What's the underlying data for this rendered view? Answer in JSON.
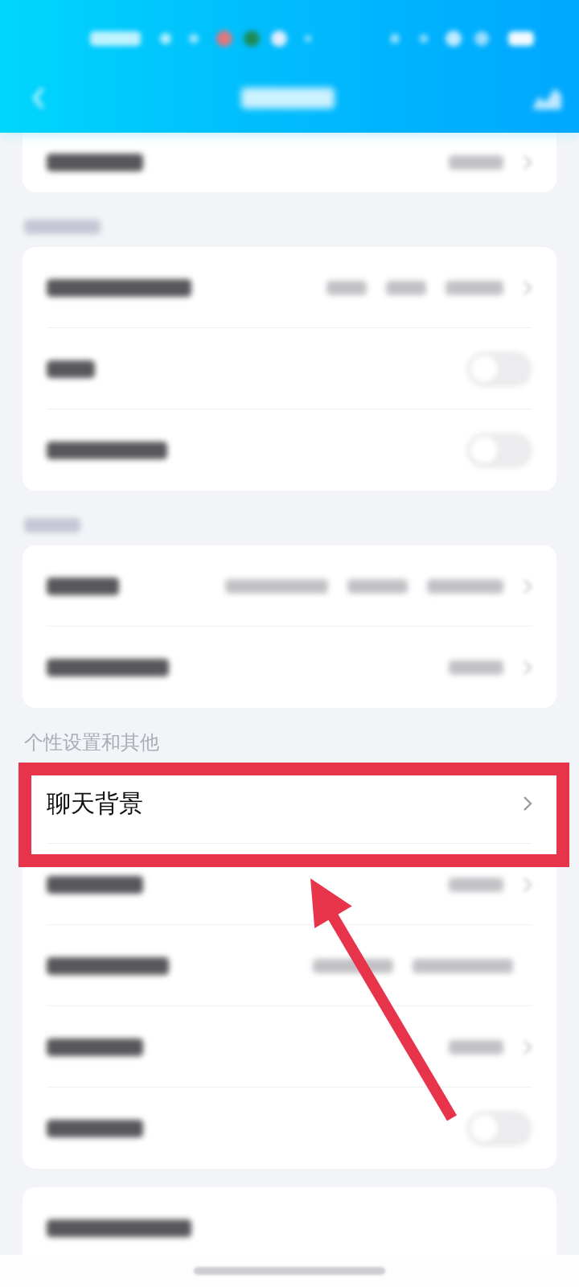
{
  "sections": [
    {
      "rows": [
        {
          "kind": "link",
          "blurred": true
        }
      ]
    },
    {
      "heading_blurred": true,
      "rows": [
        {
          "kind": "link",
          "blurred": true
        },
        {
          "kind": "switch",
          "blurred": true,
          "on": false
        },
        {
          "kind": "switch",
          "blurred": true,
          "on": false
        }
      ]
    },
    {
      "heading_blurred": true,
      "rows": [
        {
          "kind": "link",
          "blurred": true
        },
        {
          "kind": "link",
          "blurred": true
        }
      ]
    },
    {
      "heading": "个性设置和其他",
      "rows": [
        {
          "kind": "link",
          "label": "聊天背景",
          "blurred": false,
          "highlighted": true
        },
        {
          "kind": "link",
          "blurred": true
        },
        {
          "kind": "plain",
          "blurred": true
        },
        {
          "kind": "link",
          "blurred": true
        },
        {
          "kind": "switch",
          "blurred": true,
          "on": false
        }
      ]
    },
    {
      "rows": [
        {
          "kind": "plain",
          "blurred": true
        }
      ]
    }
  ],
  "annotation": {
    "arrow": true
  }
}
